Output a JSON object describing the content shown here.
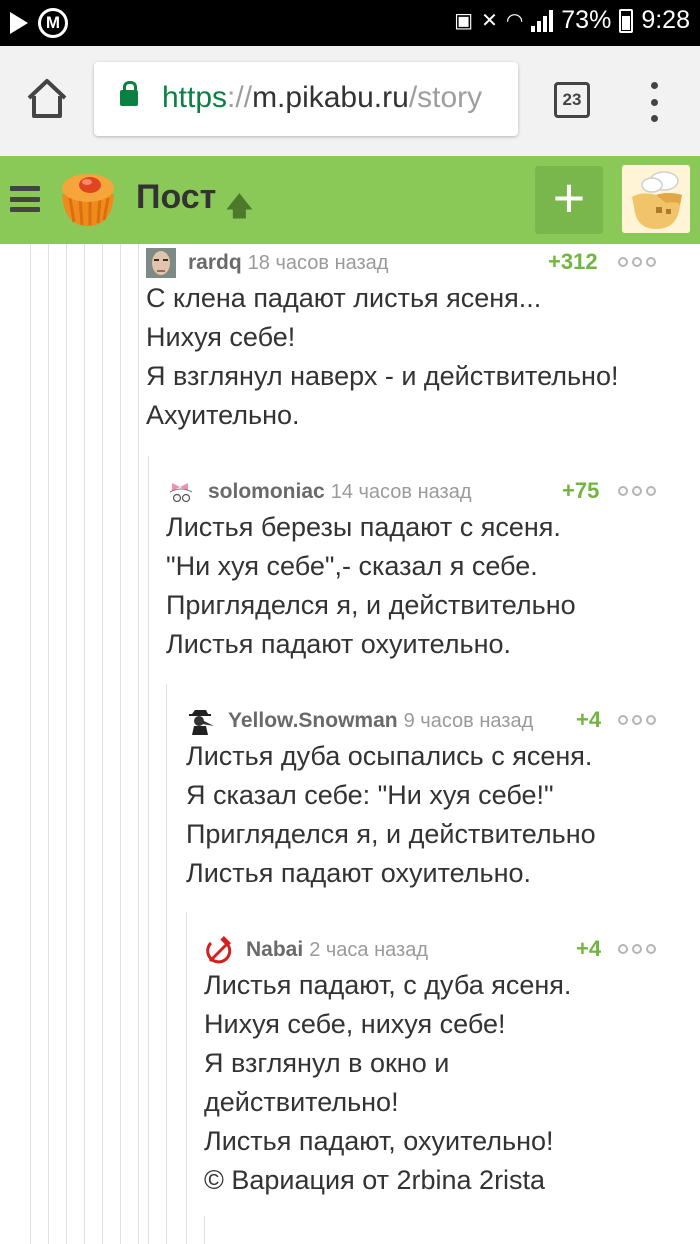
{
  "status_bar": {
    "metro_label": "М",
    "battery": "73%",
    "time": "9:28"
  },
  "browser": {
    "url_scheme": "https",
    "url_sep": "://",
    "url_host": "m.pikabu.ru",
    "url_path": "/story",
    "tab_count": "23"
  },
  "header": {
    "title": "Пост",
    "add_label": "+"
  },
  "comments": [
    {
      "user": "rardq",
      "time": "18 часов назад",
      "rating": "+312",
      "lines": [
        "С клена падают листья ясеня...",
        "Нихуя себе!",
        "Я взглянул наверх - и действительно!",
        "Ахуительно."
      ]
    },
    {
      "user": "solomoniac",
      "time": "14 часов назад",
      "rating": "+75",
      "lines": [
        "Листья березы падают с ясеня.",
        "\"Ни хуя себе\",- сказал я себе.",
        "Пригляделся я, и действительно",
        "Листья падают охуительно."
      ]
    },
    {
      "user": "Yellow.Snowman",
      "time": "9 часов назад",
      "rating": "+4",
      "lines": [
        "Листья дуба осыпались с ясеня.",
        "Я сказал себе: \"Ни хуя себе!\"",
        "Пригляделся я, и действительно",
        "Листья падают охуительно."
      ]
    },
    {
      "user": "Nabai",
      "time": "2 часа назад",
      "rating": "+4",
      "lines": [
        "Листья падают, с дуба ясеня.",
        "Нихуя себе, нихуя себе!",
        "Я взглянул в окно и",
        "действительно!",
        "Листья падают, охуительно!",
        "© Вариация от 2rbina 2rista"
      ]
    }
  ]
}
